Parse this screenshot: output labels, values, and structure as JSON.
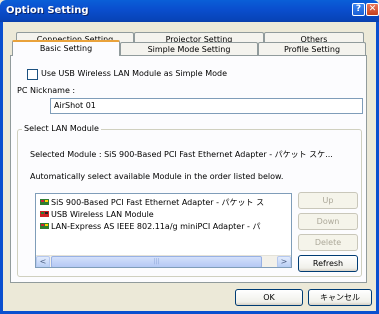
{
  "window": {
    "title": "Option Setting"
  },
  "tabs": {
    "row1": [
      "Connection Setting",
      "Projector Setting",
      "Others"
    ],
    "row2": [
      "Basic Setting",
      "Simple Mode Setting",
      "Profile Setting"
    ],
    "active": "Basic Setting"
  },
  "basic": {
    "use_usb_label": "Use USB Wireless LAN Module as Simple Mode",
    "use_usb_checked": false,
    "nickname_label": "PC Nickname :",
    "nickname_value": "AirShot 01",
    "group_label": "Select LAN Module",
    "selected_module_text": "Selected Module : SiS 900-Based PCI Fast Ethernet Adapter - パケット スケ...",
    "auto_select_text": "Automatically select available Module in the order listed below.",
    "modules": [
      {
        "label": "SiS 900-Based PCI Fast Ethernet Adapter - パケット ス",
        "icon": "network-adapter-icon"
      },
      {
        "label": "USB Wireless LAN Module",
        "icon": "network-adapter-icon"
      },
      {
        "label": "LAN-Express AS IEEE 802.11a/g miniPCI Adapter - パ",
        "icon": "network-adapter-icon"
      }
    ],
    "buttons": {
      "up": "Up",
      "down": "Down",
      "delete": "Delete",
      "refresh": "Refresh"
    }
  },
  "footer": {
    "ok": "OK",
    "cancel": "キャンセル"
  }
}
